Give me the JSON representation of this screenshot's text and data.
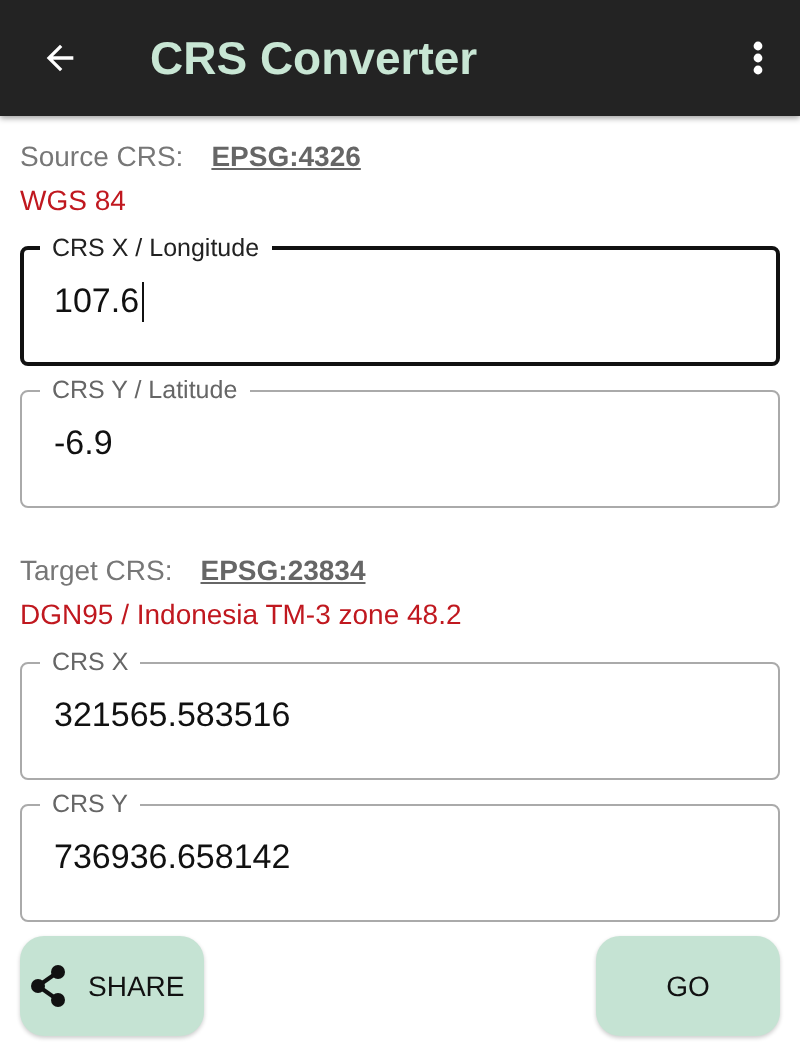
{
  "app_bar": {
    "title": "CRS Converter"
  },
  "sections": [
    {
      "label": "Source CRS:",
      "code": "EPSG:4326",
      "name": "WGS 84",
      "fields": [
        {
          "label": "CRS X / Longitude",
          "value": "107.6",
          "focused": true
        },
        {
          "label": "CRS Y / Latitude",
          "value": "-6.9",
          "focused": false
        }
      ]
    },
    {
      "label": "Target CRS:",
      "code": "EPSG:23834",
      "name": "DGN95 / Indonesia TM-3 zone 48.2",
      "fields": [
        {
          "label": "CRS X",
          "value": "321565.583516",
          "focused": false
        },
        {
          "label": "CRS Y",
          "value": "736936.658142",
          "focused": false
        }
      ]
    }
  ],
  "buttons": [
    {
      "kind": "share",
      "label": "SHARE"
    },
    {
      "kind": "go",
      "label": "GO"
    }
  ]
}
